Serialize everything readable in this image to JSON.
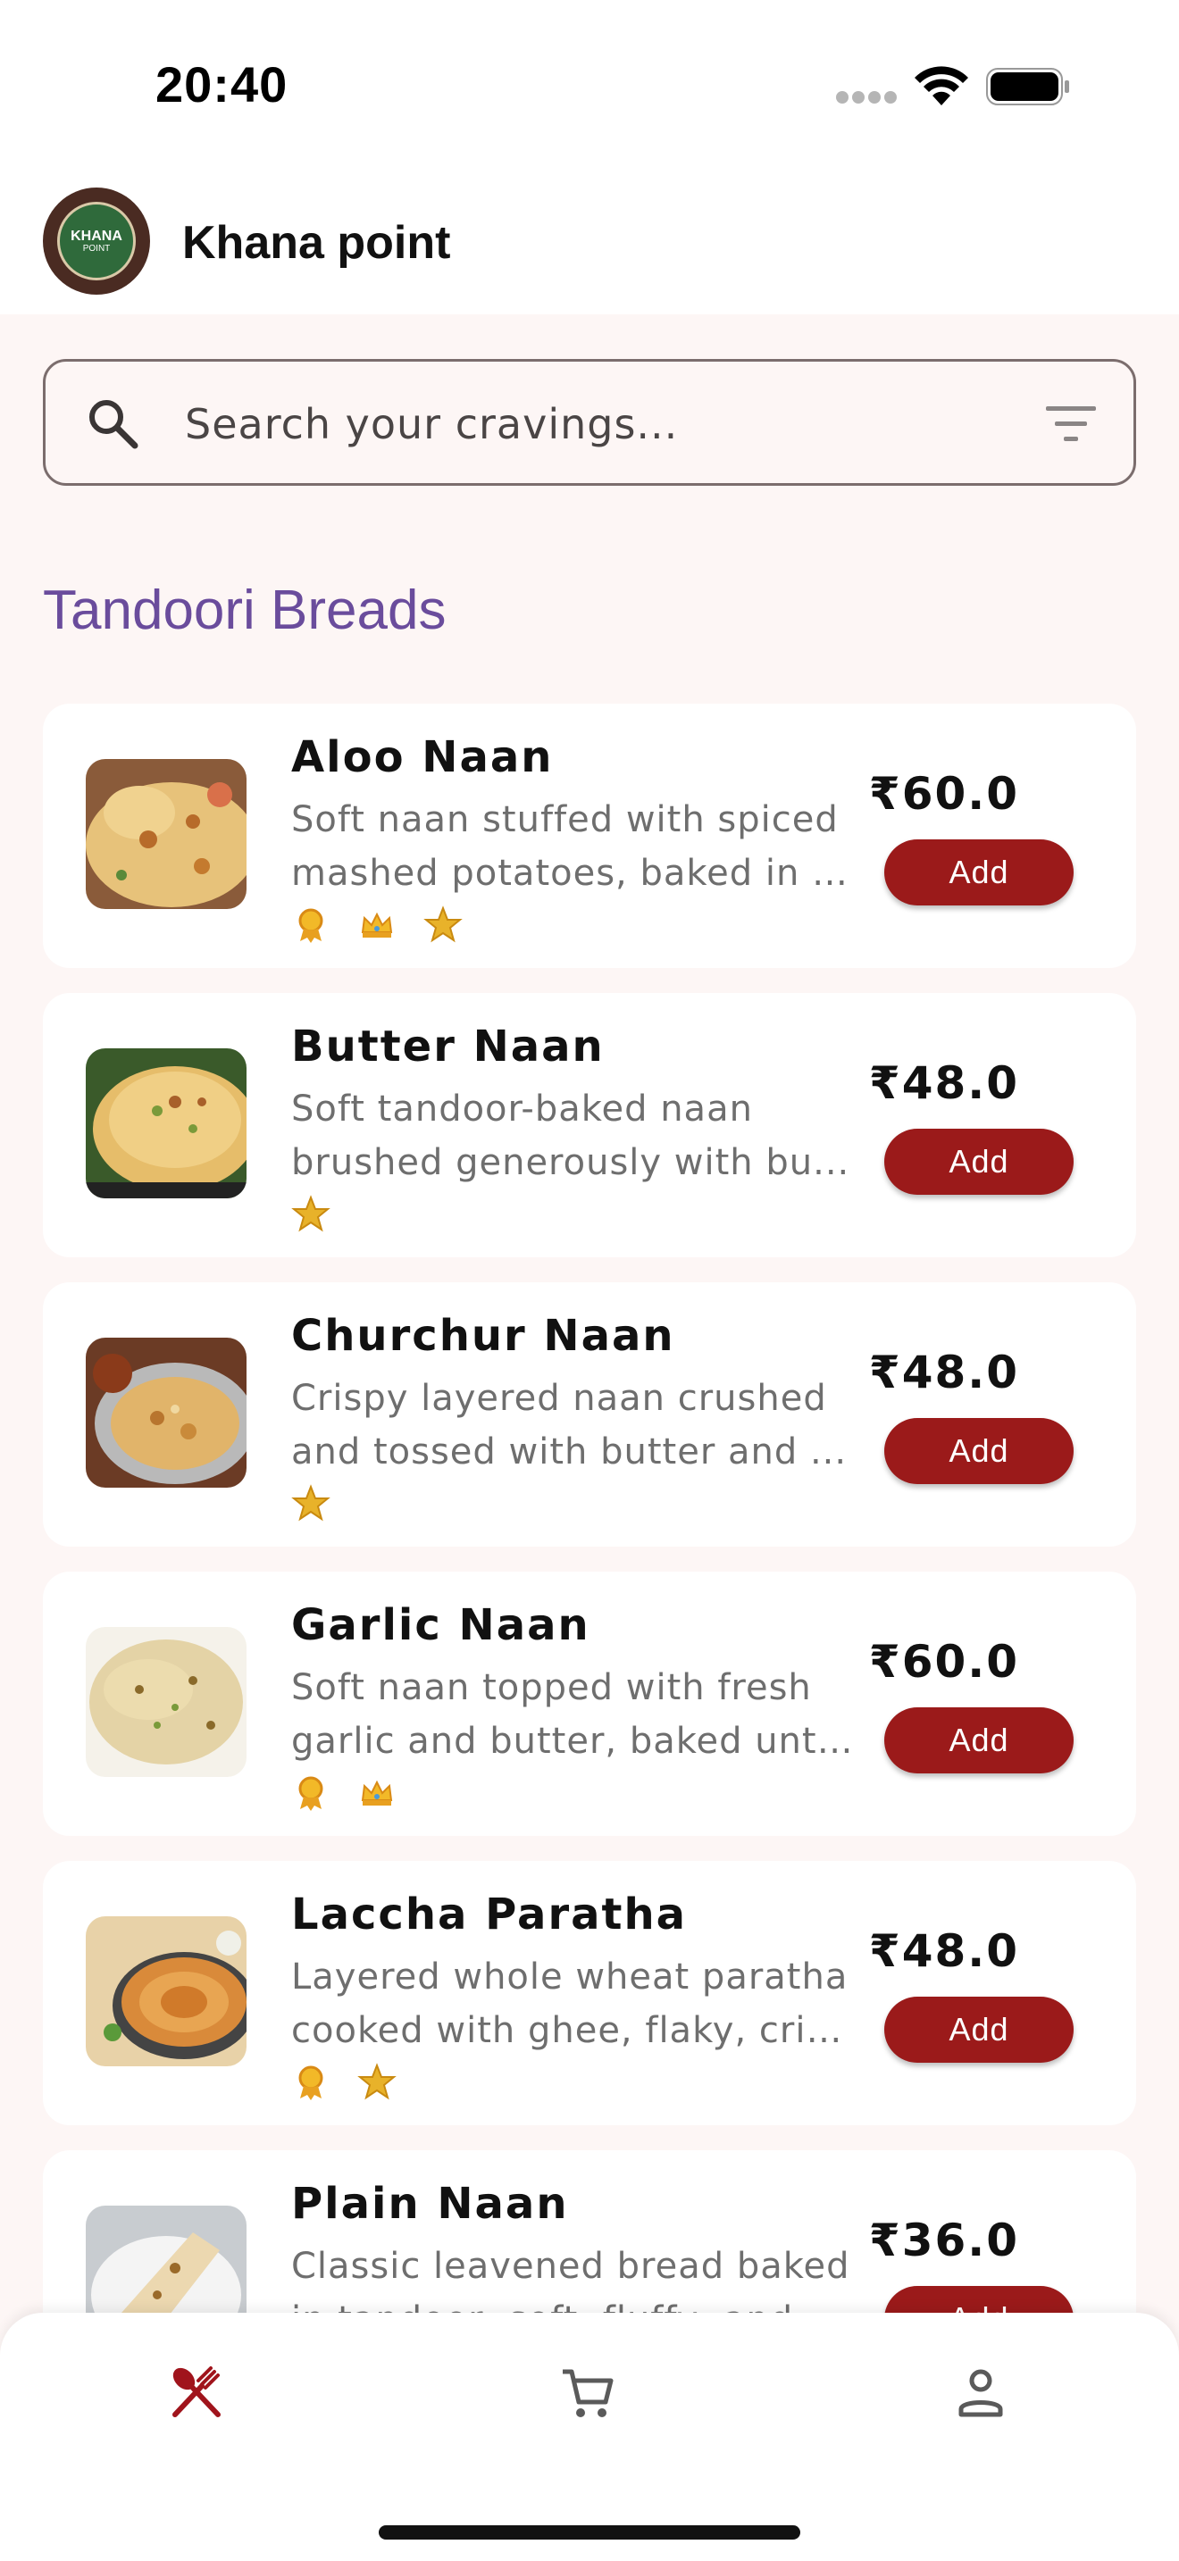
{
  "status_bar": {
    "time": "20:40"
  },
  "app": {
    "name": "Khana point",
    "logo_text": "KHANA",
    "logo_subtext": "POINT"
  },
  "search": {
    "placeholder": "Search your cravings..."
  },
  "section": {
    "title": "Tandoori Breads"
  },
  "items": [
    {
      "name": "Aloo Naan",
      "desc_line1": "Soft naan stuffed with spiced",
      "desc_line2": "mashed potatoes, baked in t...",
      "price": "₹60.0",
      "add_label": "Add",
      "badges": [
        "award-icon",
        "crown-icon",
        "star-icon"
      ]
    },
    {
      "name": "Butter Naan",
      "desc_line1": "Soft tandoor-baked naan",
      "desc_line2": "brushed generously with bu...",
      "price": "₹48.0",
      "add_label": "Add",
      "badges": [
        "star-icon"
      ]
    },
    {
      "name": "Churchur Naan",
      "desc_line1": "Crispy layered naan crushed",
      "desc_line2": "and tossed with butter and ...",
      "price": "₹48.0",
      "add_label": "Add",
      "badges": [
        "star-icon"
      ]
    },
    {
      "name": "Garlic Naan",
      "desc_line1": "Soft naan topped with fresh",
      "desc_line2": "garlic and butter, baked unti...",
      "price": "₹60.0",
      "add_label": "Add",
      "badges": [
        "award-icon",
        "crown-icon"
      ]
    },
    {
      "name": "Laccha Paratha",
      "desc_line1": "Layered whole wheat paratha",
      "desc_line2": "cooked with ghee, flaky, cris...",
      "price": "₹48.0",
      "add_label": "Add",
      "badges": [
        "award-icon",
        "star-icon"
      ]
    },
    {
      "name": "Plain Naan",
      "desc_line1": "Classic leavened bread baked",
      "desc_line2": "in tandoor, soft, fluffy, and s...",
      "price": "₹36.0",
      "add_label": "Add",
      "badges": []
    }
  ],
  "bottom_nav": {
    "items": [
      {
        "icon": "restaurant-icon",
        "active": true
      },
      {
        "icon": "cart-icon",
        "active": false
      },
      {
        "icon": "person-icon",
        "active": false
      }
    ]
  },
  "colors": {
    "accent": "#9b1a1a",
    "section_title": "#6a4c9c",
    "background": "#fdf6f5"
  }
}
